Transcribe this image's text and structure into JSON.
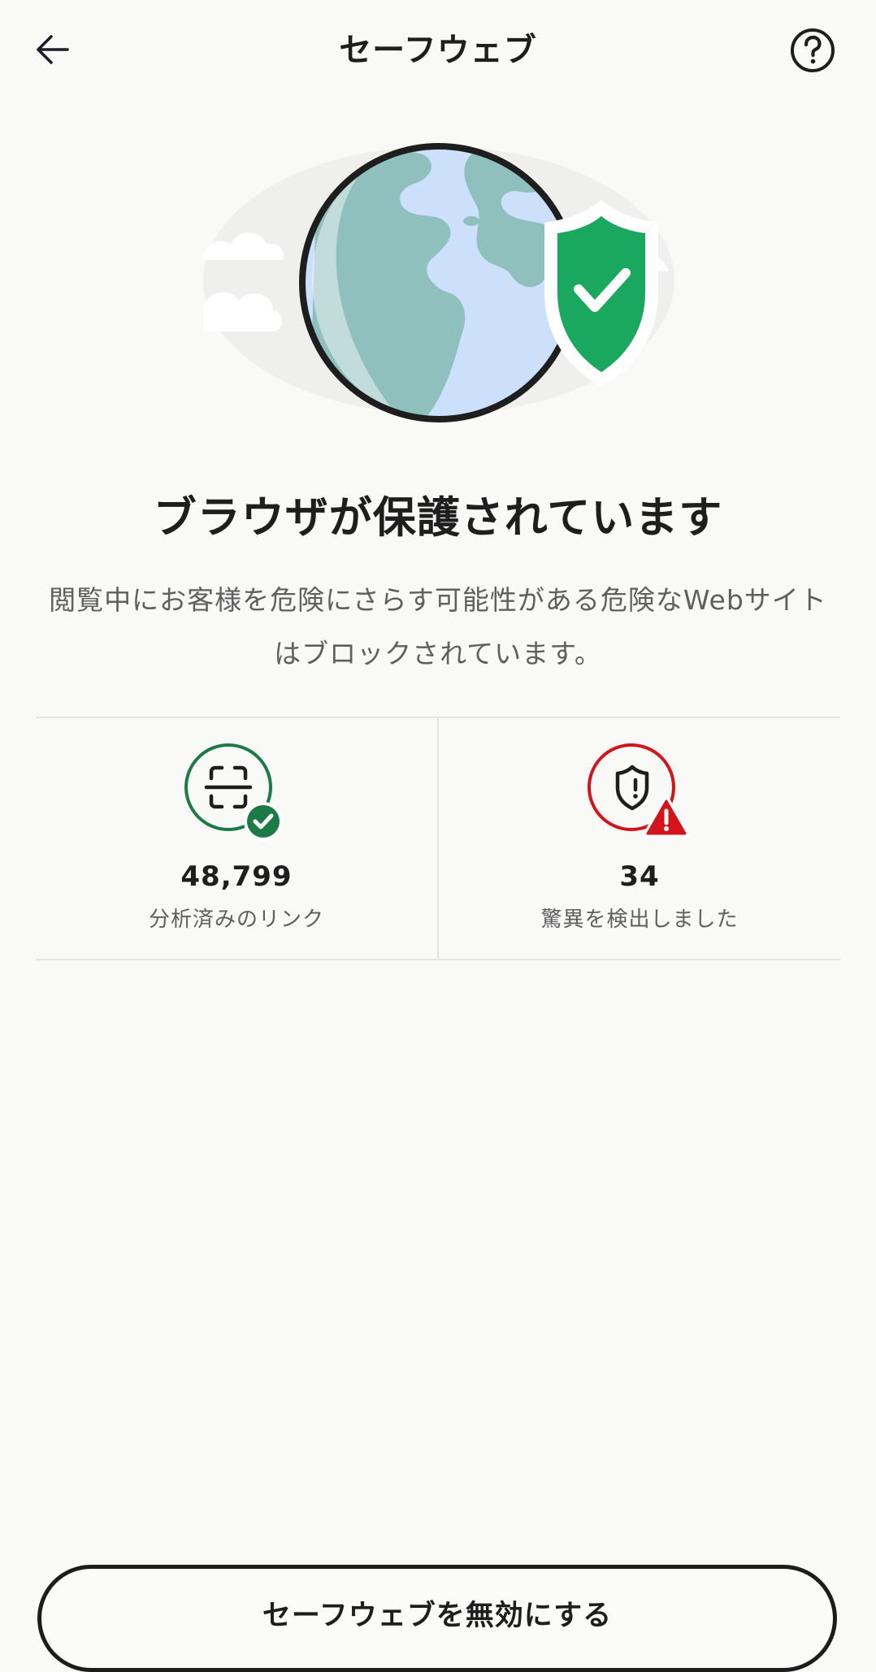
{
  "header": {
    "title": "セーフウェブ",
    "back_icon": "arrow-left-icon",
    "help_icon": "question-circle-icon"
  },
  "hero": {
    "illustration": "globe-with-shield-check-icon"
  },
  "main": {
    "headline": "ブラウザが保護されています",
    "description": "閲覧中にお客様を危険にさらす可能性がある危険なWebサイトはブロックされています。"
  },
  "stats": [
    {
      "value": "48,799",
      "label": "分析済みのリンク",
      "icon": "scan-link-check-icon",
      "color": "#1b7a45"
    },
    {
      "value": "34",
      "label": "驚異を検出しました",
      "icon": "shield-warning-icon",
      "color": "#d3141b"
    }
  ],
  "actions": {
    "disable_label": "セーフウェブを無効にする"
  }
}
